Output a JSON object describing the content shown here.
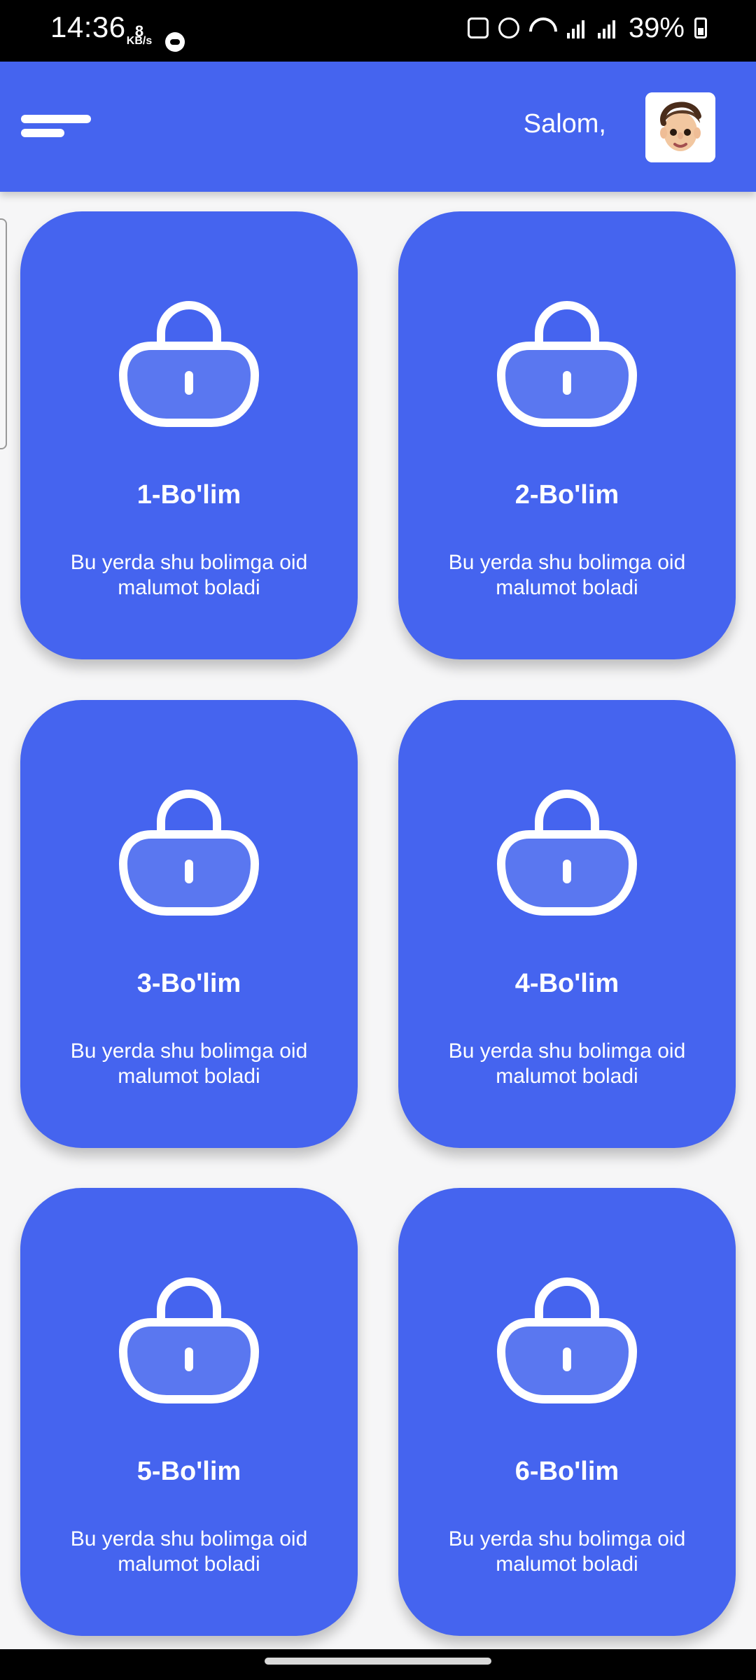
{
  "status_bar": {
    "time": "14:36",
    "speed_value": "8",
    "speed_unit": "KB/s",
    "battery": "39%"
  },
  "header": {
    "greeting": "Salom,",
    "menu_icon": "menu-icon",
    "avatar_icon": "avatar-icon"
  },
  "cards": [
    {
      "title": "1-Bo'lim",
      "description": "Bu yerda shu bolimga oid malumot boladi",
      "icon": "lock-icon"
    },
    {
      "title": "2-Bo'lim",
      "description": "Bu yerda shu bolimga oid malumot boladi",
      "icon": "lock-icon"
    },
    {
      "title": "3-Bo'lim",
      "description": "Bu yerda shu bolimga oid malumot boladi",
      "icon": "lock-icon"
    },
    {
      "title": "4-Bo'lim",
      "description": "Bu yerda shu bolimga oid malumot boladi",
      "icon": "lock-icon"
    },
    {
      "title": "5-Bo'lim",
      "description": "Bu yerda shu bolimga oid malumot boladi",
      "icon": "lock-icon"
    },
    {
      "title": "6-Bo'lim",
      "description": "Bu yerda shu bolimga oid malumot boladi",
      "icon": "lock-icon"
    }
  ],
  "colors": {
    "primary": "#4564ef",
    "background": "#f6f6f7",
    "text_on_primary": "#ffffff"
  }
}
